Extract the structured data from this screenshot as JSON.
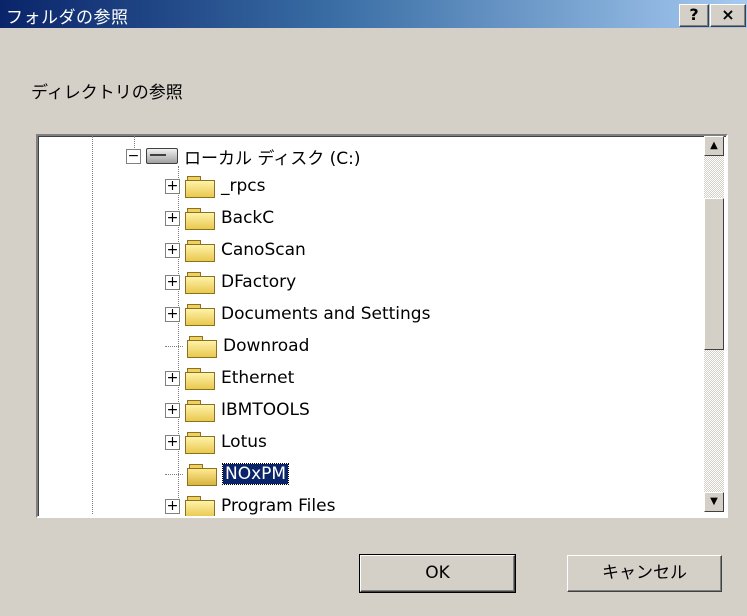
{
  "window": {
    "title": "フォルダの参照",
    "help_label": "?",
    "close_label": "×"
  },
  "prompt": "ディレクトリの参照",
  "tree": {
    "root": {
      "label": "ローカル ディスク (C:)",
      "expander": "−",
      "icon": "hard-drive-icon"
    },
    "items": [
      {
        "label": "_rpcs",
        "expander": "+",
        "selected": false
      },
      {
        "label": "BackC",
        "expander": "+",
        "selected": false
      },
      {
        "label": "CanoScan",
        "expander": "+",
        "selected": false
      },
      {
        "label": "DFactory",
        "expander": "+",
        "selected": false
      },
      {
        "label": "Documents and Settings",
        "expander": "+",
        "selected": false
      },
      {
        "label": "Downroad",
        "expander": "",
        "selected": false
      },
      {
        "label": "Ethernet",
        "expander": "+",
        "selected": false
      },
      {
        "label": "IBMTOOLS",
        "expander": "+",
        "selected": false
      },
      {
        "label": "Lotus",
        "expander": "+",
        "selected": false
      },
      {
        "label": "NOxPM",
        "expander": "",
        "selected": true
      },
      {
        "label": "Program Files",
        "expander": "+",
        "selected": false
      }
    ]
  },
  "scrollbar": {
    "up_glyph": "▲",
    "down_glyph": "▼"
  },
  "buttons": {
    "ok": "OK",
    "cancel": "キャンセル"
  },
  "colors": {
    "selection": "#0a246a",
    "face": "#d4d0c8"
  }
}
